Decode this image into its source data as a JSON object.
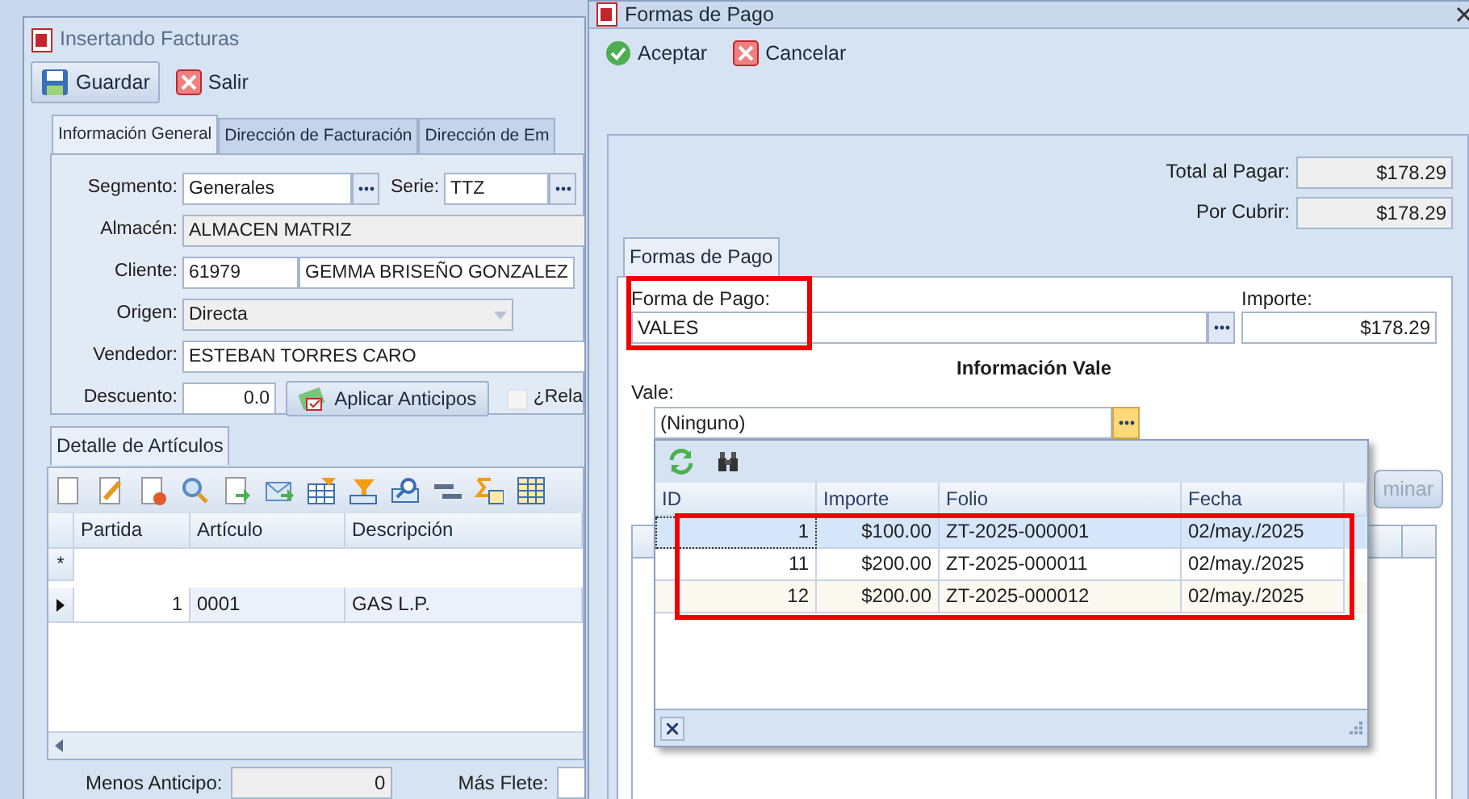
{
  "invoice_window": {
    "title": "Insertando Facturas",
    "toolbar": [
      {
        "label": "Guardar",
        "kind": "save",
        "pressed": true
      },
      {
        "label": "Salir",
        "kind": "exit",
        "pressed": false
      }
    ],
    "tabs": [
      {
        "label": "Información General",
        "selected": true
      },
      {
        "label": "Dirección de Facturación",
        "selected": false
      },
      {
        "label": "Dirección de Em",
        "selected": false
      }
    ],
    "segmento": {
      "label": "Segmento:",
      "value": "Generales"
    },
    "serie": {
      "label": "Serie:",
      "value": "TTZ"
    },
    "almacen": {
      "label": "Almacén:",
      "value": "ALMACEN MATRIZ",
      "readonly": true
    },
    "cliente": {
      "label": "Cliente:",
      "code": "61979",
      "name": "GEMMA BRISEÑO GONZALEZ"
    },
    "origen": {
      "label": "Origen:",
      "value": "Directa",
      "disabled": true
    },
    "vendedor": {
      "label": "Vendedor:",
      "value": "ESTEBAN TORRES CARO"
    },
    "descuento": {
      "label": "Descuento:",
      "value": "0.0"
    },
    "anticipos_button": "Aplicar Anticipos",
    "relacion_checkbox": {
      "label": "¿Rela",
      "checked": false
    },
    "detail": {
      "tab": "Detalle de Artículos",
      "columns": [
        "Partida",
        "Artículo",
        "Descripción"
      ],
      "new_row_marker": "*",
      "rows": [
        {
          "partida": "1",
          "articulo": "0001",
          "descripcion": "GAS L.P.",
          "current": true
        }
      ]
    },
    "footer": [
      {
        "label": "Menos Anticipo:",
        "value": "0"
      },
      {
        "label": "Más Flete:"
      }
    ]
  },
  "payment_window": {
    "title": "Formas de Pago",
    "toolbar": [
      {
        "label": "Aceptar",
        "kind": "accept"
      },
      {
        "label": "Cancelar",
        "kind": "cancel"
      }
    ],
    "totals": [
      {
        "label": "Total al Pagar:",
        "value": "$178.29"
      },
      {
        "label": "Por Cubrir:",
        "value": "$178.29"
      }
    ],
    "tab": "Formas de Pago",
    "forma_de_pago": {
      "label": "Forma de Pago:",
      "value": "VALES",
      "highlighted": true
    },
    "importe": {
      "label": "Importe:",
      "value": "$178.29"
    },
    "section_title": "Información Vale",
    "vale": {
      "label": "Vale:",
      "value": "(Ninguno)",
      "expanded": true
    },
    "side_button": {
      "label": "minar",
      "disabled": true
    },
    "vale_popup": {
      "columns": [
        "ID",
        "Importe",
        "Folio",
        "Fecha"
      ],
      "rows_highlighted": true,
      "rows": [
        {
          "id": "1",
          "importe": "$100.00",
          "folio": "ZT-2025-000001",
          "fecha": "02/may./2025",
          "selected": true
        },
        {
          "id": "11",
          "importe": "$200.00",
          "folio": "ZT-2025-000011",
          "fecha": "02/may./2025",
          "selected": false
        },
        {
          "id": "12",
          "importe": "$200.00",
          "folio": "ZT-2025-000012",
          "fecha": "02/may./2025",
          "selected": false
        }
      ]
    }
  }
}
